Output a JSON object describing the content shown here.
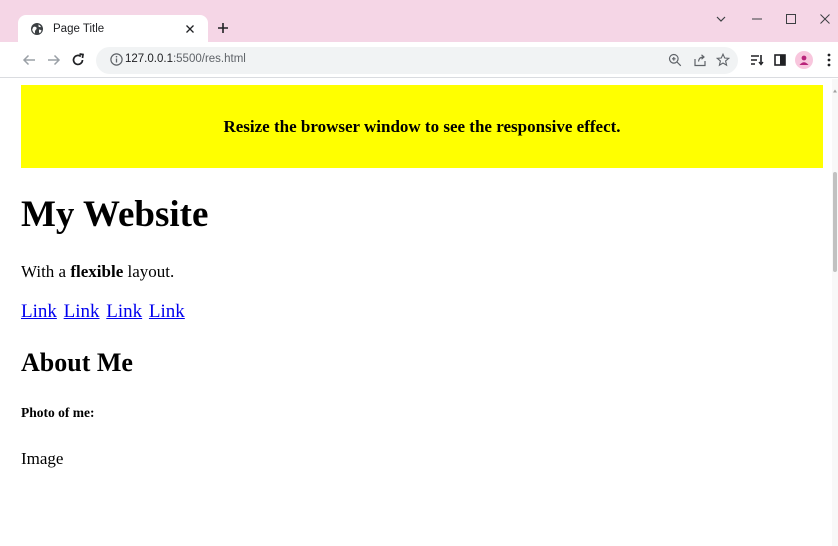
{
  "browser": {
    "tab": {
      "title": "Page Title",
      "favicon": "globe-icon"
    },
    "url": {
      "host": "127.0.0.1",
      "path": ":5500/res.html"
    },
    "window_controls": [
      "tab-search",
      "minimize",
      "maximize",
      "close"
    ],
    "toolbar_icons": [
      "zoom",
      "share",
      "bookmark-star",
      "reading-list",
      "side-panel",
      "profile-avatar",
      "menu"
    ],
    "colors": {
      "titlebar": "#f5d6e6",
      "omnibox": "#f1f3f4",
      "avatar": "#f8c6dd",
      "avatar_icon": "#b9237a"
    }
  },
  "page": {
    "banner_text": "Resize the browser window to see the responsive effect.",
    "banner_color": "#ffff00",
    "heading": "My Website",
    "intro": {
      "before": "With a ",
      "bold": "flexible",
      "after": " layout."
    },
    "links": [
      "Link",
      "Link",
      "Link",
      "Link"
    ],
    "about_heading": "About Me",
    "photo_label": "Photo of me:",
    "image_text": "Image",
    "link_color": "#0000ee"
  }
}
